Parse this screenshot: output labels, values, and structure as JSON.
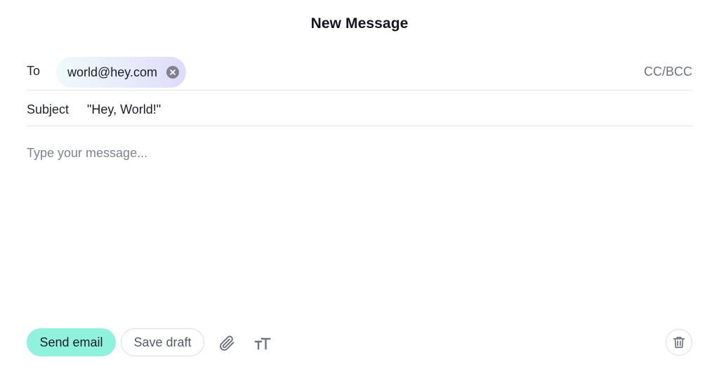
{
  "window": {
    "title": "New Message"
  },
  "to": {
    "label": "To",
    "recipients": [
      {
        "address": "world@hey.com"
      }
    ],
    "cc_bcc_label": "CC/BCC"
  },
  "subject": {
    "label": "Subject",
    "value": "\"Hey, World!\""
  },
  "message": {
    "placeholder": "Type your message...",
    "value": ""
  },
  "toolbar": {
    "send_label": "Send email",
    "draft_label": "Save draft",
    "icons": [
      "paperclip-icon",
      "text-format-icon",
      "trash-icon",
      "close-icon"
    ]
  },
  "colors": {
    "send_button": "#8ef2dc",
    "chip_gradient_start": "#effaf9",
    "chip_gradient_end": "#dcdcfb",
    "muted_text": "#6f7280"
  }
}
